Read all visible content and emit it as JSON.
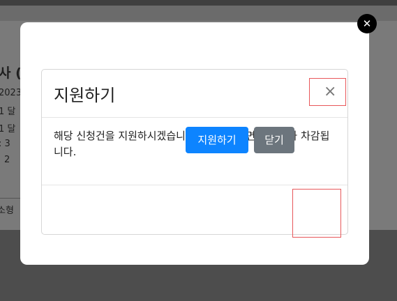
{
  "background": {
    "heading_fragment": "사 (",
    "date_fragment": "2023-",
    "line1": "1 달",
    "line2": "1 달",
    "count_a": ": 3",
    "count_b": "2",
    "footer_fragment": "소형"
  },
  "lightbox": {
    "close_glyph": "✕"
  },
  "modal": {
    "title": "지원하기",
    "close_glyph": "×",
    "body": "해당 신청건을 지원하시겠습니까? 지원을 하면 포인트가 차감됩니다.",
    "apply_button": "지원하기",
    "close_button": "닫기"
  }
}
